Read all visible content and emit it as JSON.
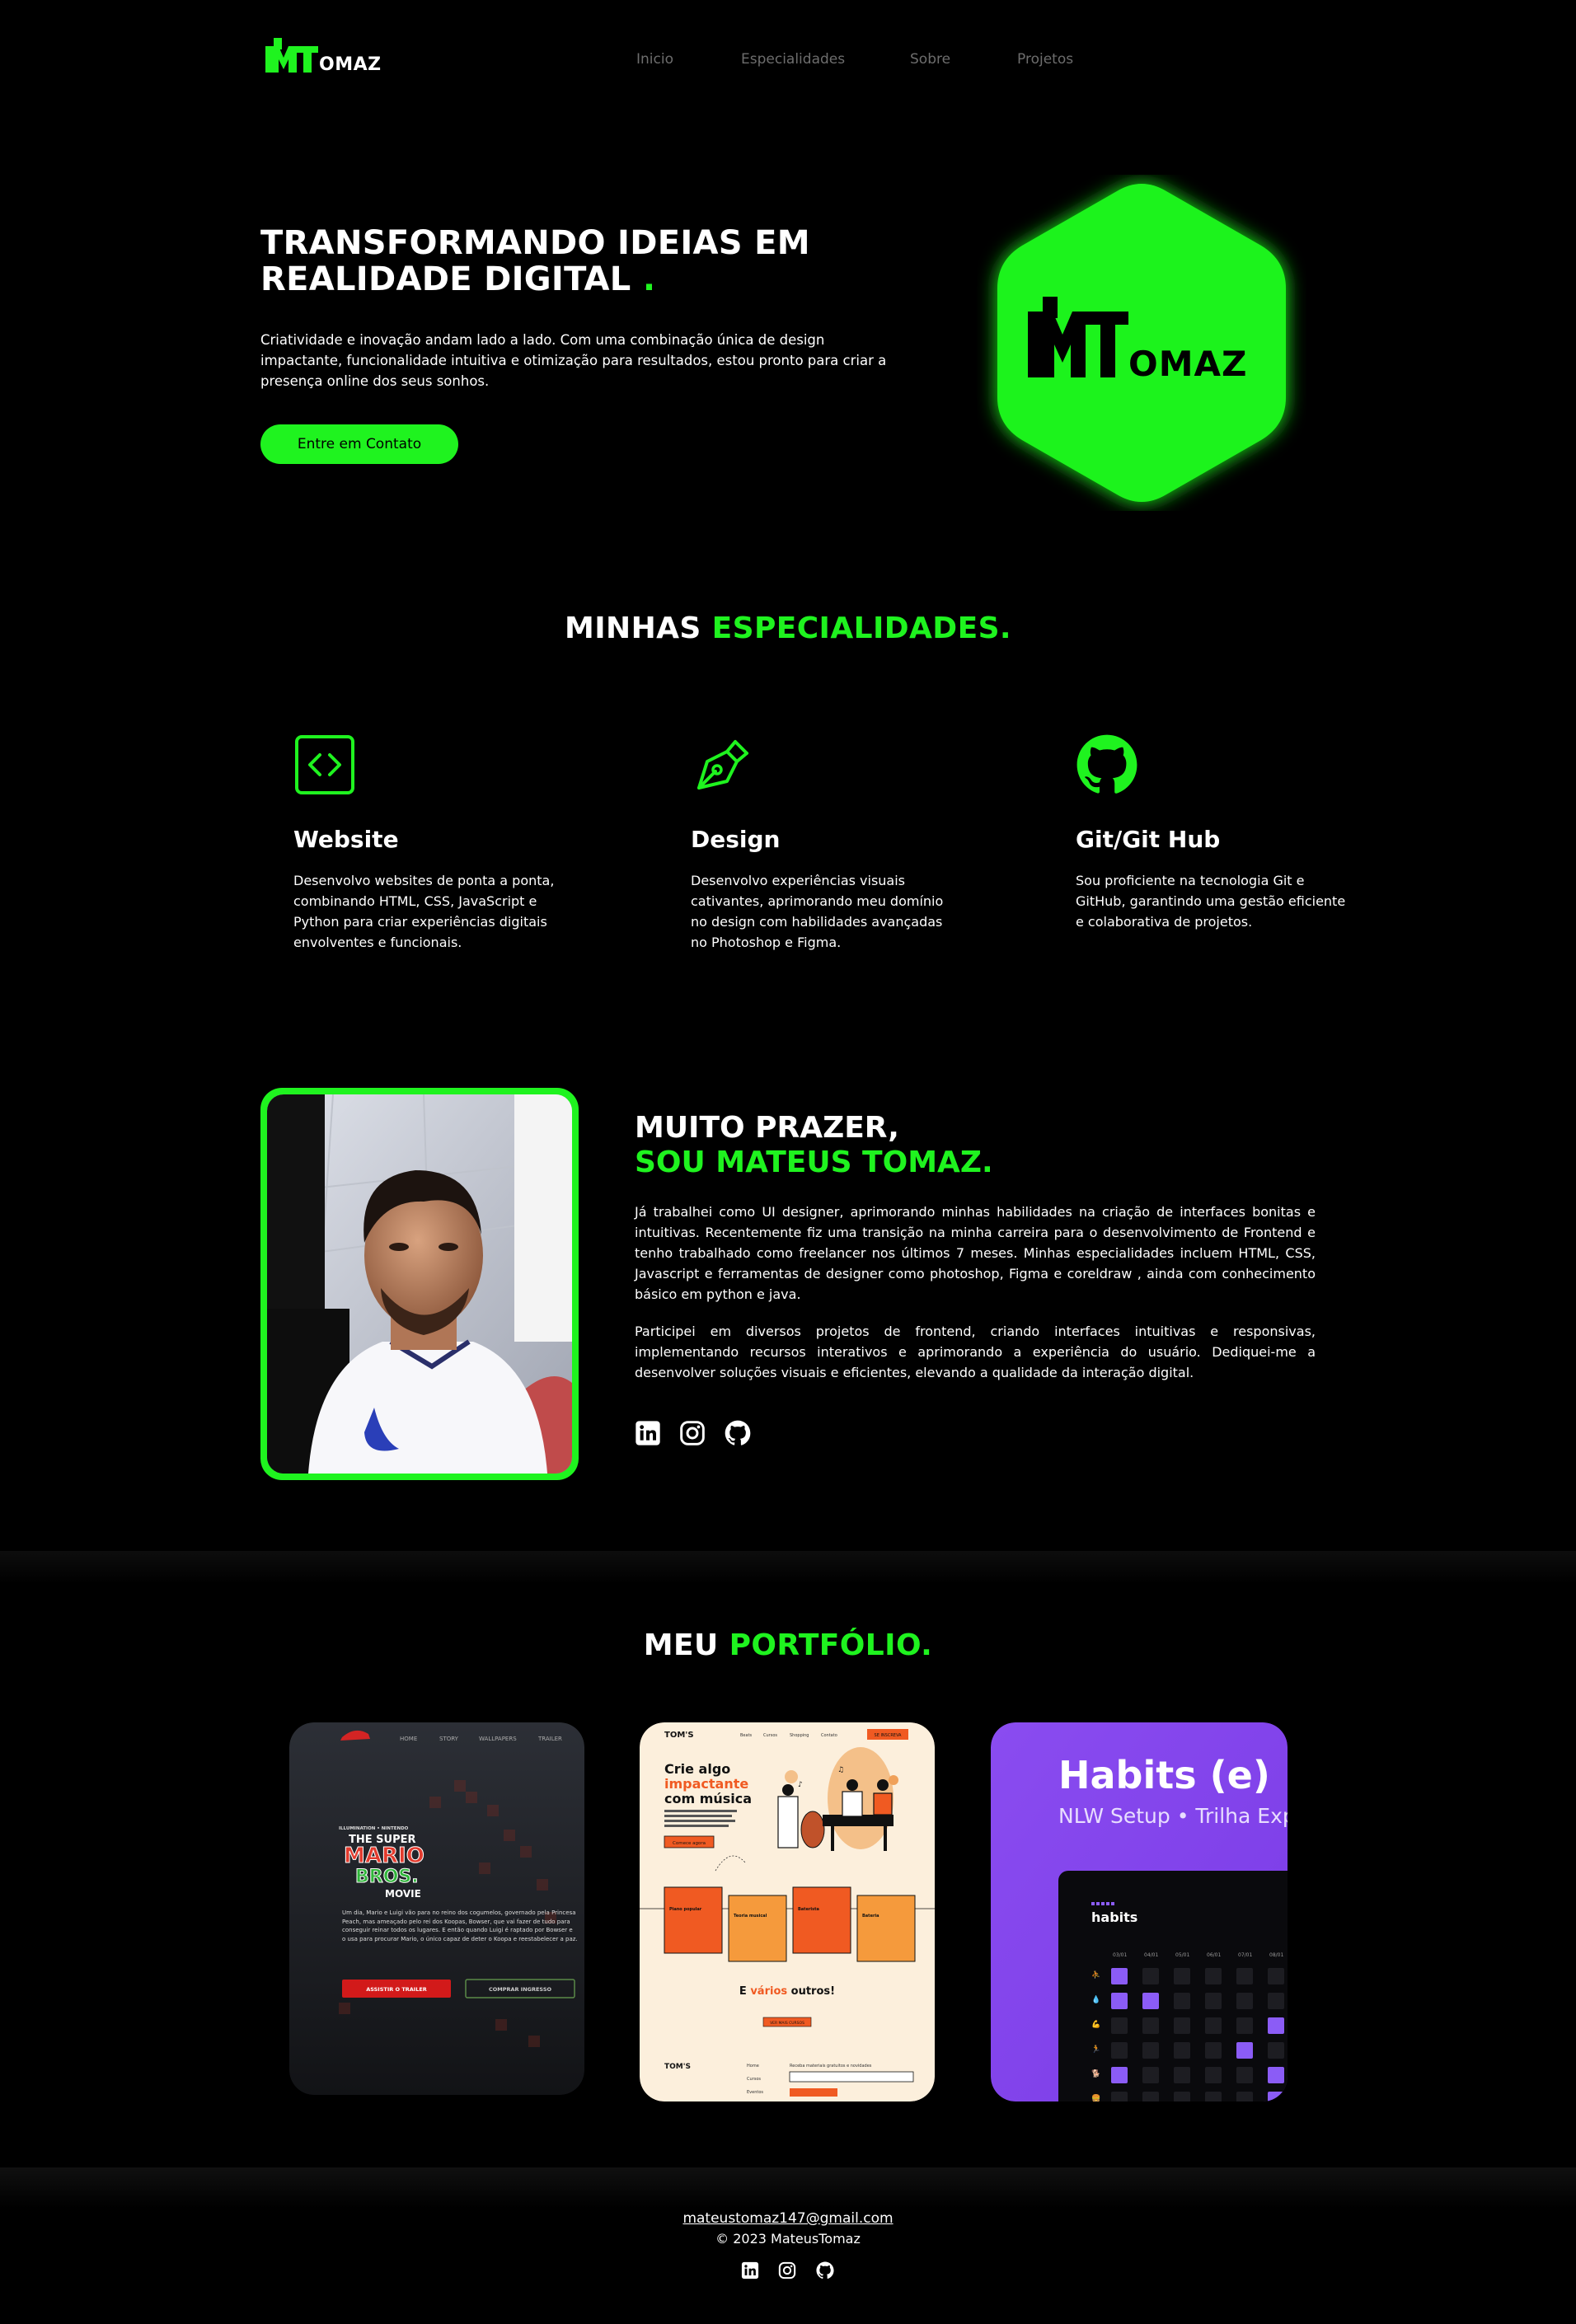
{
  "nav": {
    "logo_text": "MTomaz",
    "links": [
      "Inicio",
      "Especialidades",
      "Sobre",
      "Projetos"
    ]
  },
  "hero": {
    "title_line1": "TRANSFORMANDO IDEIAS EM",
    "title_line2": "REALIDADE DIGITAL",
    "title_dot": ".",
    "text": "Criatividade e inovação andam lado a lado. Com uma combinação única de design impactante, funcionalidade intuitiva e otimização para resultados, estou pronto para criar a presença online dos seus sonhos.",
    "cta_label": "Entre em Contato",
    "emblem_text": "MTomaz"
  },
  "specialties": {
    "title_white": "MINHAS",
    "title_green": "ESPECIALIDADES.",
    "items": [
      {
        "icon": "code-brackets-icon",
        "title": "Website",
        "text": "Desenvolvo websites de ponta a ponta, combinando HTML, CSS, JavaScript e Python para criar experiências digitais envolventes e funcionais."
      },
      {
        "icon": "pen-nib-icon",
        "title": "Design",
        "text": "Desenvolvo experiências visuais cativantes, aprimorando meu domínio no design com habilidades avançadas no Photoshop e Figma."
      },
      {
        "icon": "github-icon",
        "title": "Git/Git Hub",
        "text": "Sou proficiente na tecnologia Git e GitHub, garantindo uma gestão eficiente e colaborativa de projetos."
      }
    ]
  },
  "about": {
    "title_line1": "MUITO PRAZER,",
    "title_line2": "SOU MATEUS TOMAZ.",
    "paragraph1": "Já trabalhei como UI designer, aprimorando minhas habilidades na criação de interfaces bonitas e intuitivas. Recentemente fiz uma transição na minha carreira para o desenvolvimento de Frontend e tenho trabalhado como freelancer nos últimos 7 meses. Minhas especialidades incluem HTML, CSS, Javascript e ferramentas de designer como photoshop, Figma e coreldraw , ainda com conhecimento básico em python e java.",
    "paragraph2": "Participei em diversos projetos de frontend, criando interfaces intuitivas e responsivas, implementando recursos interativos e aprimorando a experiência do usuário. Dediquei-me a desenvolver soluções visuais e eficientes, elevando a qualidade da interação digital.",
    "social": [
      "linkedin-icon",
      "instagram-icon",
      "github-icon"
    ]
  },
  "portfolio": {
    "title_white": "MEU",
    "title_green": "PORTFÓLIO.",
    "mario": {
      "nav": [
        "HOME",
        "STORY",
        "WALLPAPERS",
        "TRAILER"
      ],
      "logo_top": "ILLUMINATION • NINTENDO",
      "logo_the": "THE SUPER",
      "logo_mario": "MARIO",
      "logo_bros": "BROS.",
      "logo_movie": "MOVIE",
      "text": "Um dia, Mario e Luigi vão para no reino dos cogumelos, governado pela Princesa Peach, mas ameaçado pelo rei dos Koopas, Bowser, que vai fazer de tudo para conseguir reinar todos os lugares. E então quando Luigi é raptado por Bowser e o usa para procurar Mario, o único capaz de deter o Koopa e reestabelecer a paz.",
      "btn1": "ASSISTIR O TRAILER",
      "btn2": "COMPRAR INGRESSO"
    },
    "toms": {
      "brand": "TOM'S",
      "nav": [
        "Beats",
        "Cursos",
        "Shopping",
        "Contato"
      ],
      "nav_btn": "SE INSCREVA",
      "headline1": "Crie algo",
      "headline2": "impactante",
      "headline3": "com música",
      "cta": "Comece agora",
      "cards": [
        "Piano popular",
        "Teoria musical",
        "Baterista",
        "Bateria"
      ],
      "mid_title_a": "E ",
      "mid_title_b": "vários",
      "mid_title_c": " outros!",
      "mid_btn": "VER MAIS CURSOS",
      "footer_brand": "TOM'S",
      "footer_links": [
        "Home",
        "Cursos",
        "Eventos"
      ],
      "footer_label": "Receba materiais gratuitos e novidades"
    },
    "habits": {
      "title": "Habits (e)",
      "subtitle": "NLW Setup • Trilha Expl",
      "app_title": "habits",
      "dates": [
        "03/01",
        "04/01",
        "05/01",
        "06/01",
        "07/01",
        "08/01"
      ]
    }
  },
  "footer": {
    "email": "mateustomaz147@gmail.com",
    "copyright": "© 2023 MateusTomaz",
    "social": [
      "linkedin-icon",
      "instagram-icon",
      "github-icon"
    ]
  },
  "colors": {
    "accent": "#1ff31f",
    "background": "#000000",
    "habits_purple": "#8b5cf6",
    "toms_orange": "#f05a22"
  }
}
